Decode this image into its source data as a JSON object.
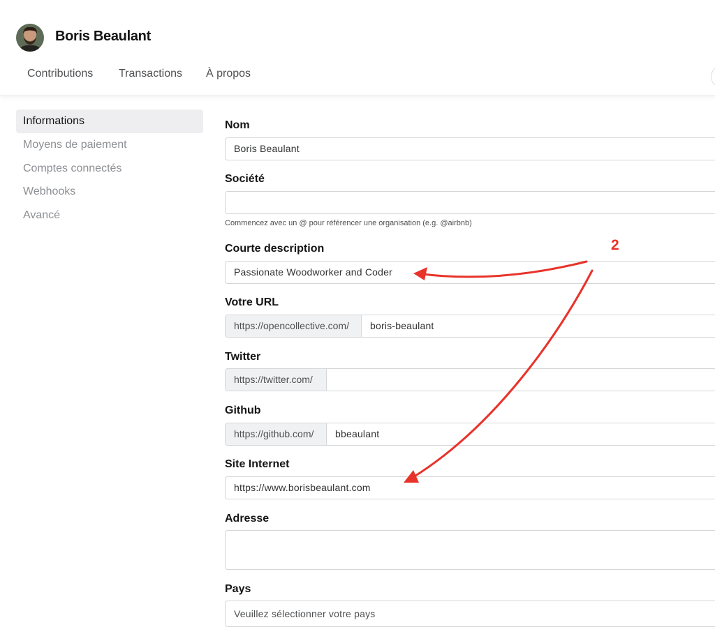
{
  "profile": {
    "name": "Boris Beaulant"
  },
  "nav": {
    "tabs": [
      "Contributions",
      "Transactions",
      "À propos"
    ]
  },
  "sidebar": {
    "items": [
      {
        "label": "Informations"
      },
      {
        "label": "Moyens de paiement"
      },
      {
        "label": "Comptes connectés"
      },
      {
        "label": "Webhooks"
      },
      {
        "label": "Avancé"
      }
    ]
  },
  "form": {
    "name": {
      "label": "Nom",
      "value": "Boris Beaulant"
    },
    "company": {
      "label": "Société",
      "value": "",
      "help": "Commencez avec un @ pour référencer une organisation (e.g. @airbnb)"
    },
    "description": {
      "label": "Courte description",
      "value": "Passionate Woodworker and Coder"
    },
    "url": {
      "label": "Votre URL",
      "prefix": "https://opencollective.com/",
      "value": "boris-beaulant"
    },
    "twitter": {
      "label": "Twitter",
      "prefix": "https://twitter.com/",
      "value": ""
    },
    "github": {
      "label": "Github",
      "prefix": "https://github.com/",
      "value": "bbeaulant"
    },
    "website": {
      "label": "Site Internet",
      "value": "https://www.borisbeaulant.com"
    },
    "address": {
      "label": "Adresse",
      "value": ""
    },
    "country": {
      "label": "Pays",
      "placeholder": "Veuillez sélectionner votre pays"
    }
  },
  "annotation": {
    "number": "2",
    "color": "#e8332a"
  }
}
